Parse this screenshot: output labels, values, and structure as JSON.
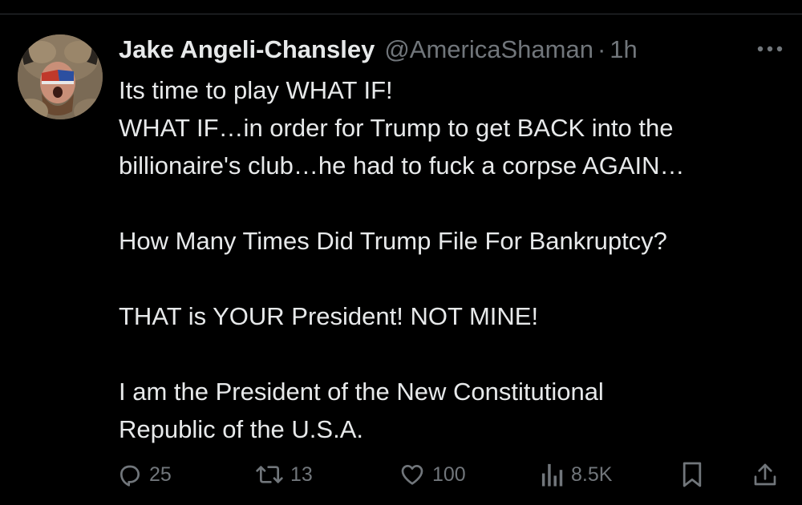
{
  "tweet": {
    "author": {
      "display_name": "Jake Angeli-Chansley",
      "handle": "@AmericaShaman",
      "separator": "·",
      "time": "1h"
    },
    "body": {
      "lines": [
        "Its time to play WHAT IF!",
        "WHAT IF…in order for Trump to get BACK into the",
        "billionaire's club…he had to fuck a corpse AGAIN…",
        "How Many Times Did Trump File For Bankruptcy?",
        "THAT is YOUR President! NOT MINE!",
        "I am the President of the New Constitutional",
        "Republic of the U.S.A."
      ]
    },
    "actions": {
      "replies": "25",
      "reposts": "13",
      "likes": "100",
      "views": "8.5K"
    }
  },
  "icons": {
    "more": "more-horizontal-icon",
    "reply": "reply-icon",
    "repost": "repost-icon",
    "like": "heart-icon",
    "views": "views-bar-chart-icon",
    "bookmark": "bookmark-icon",
    "share": "share-icon"
  },
  "colors": {
    "background": "#000000",
    "text_primary": "#e7e9ea",
    "text_secondary": "#71767b",
    "divider": "#2f3336"
  }
}
